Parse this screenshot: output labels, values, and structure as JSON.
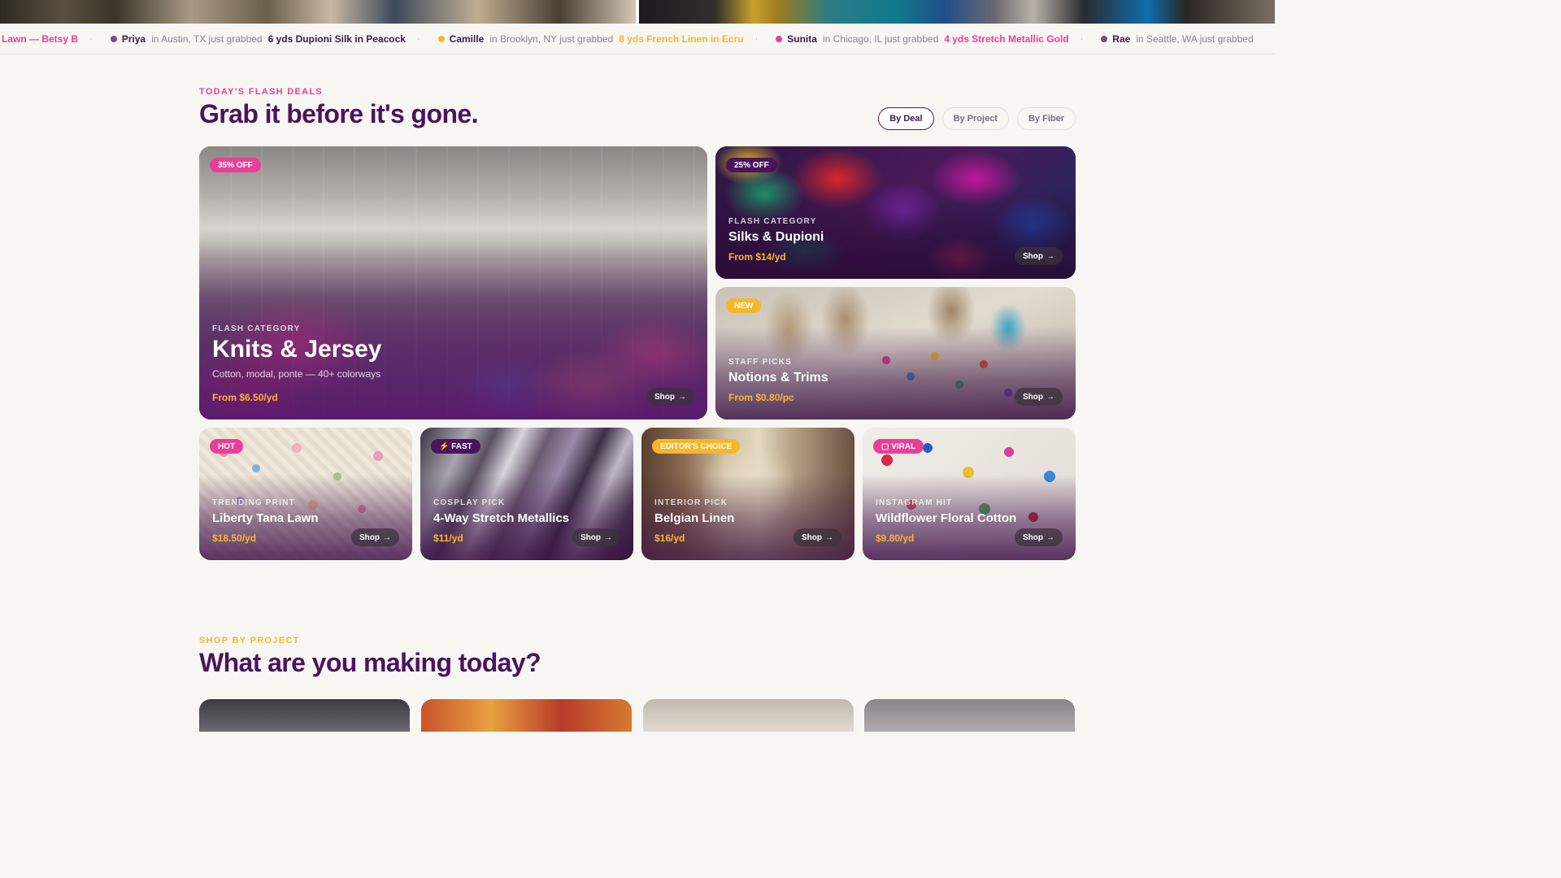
{
  "ticker": {
    "lead": "Lawn — Betsy B",
    "separator": "·",
    "items": [
      {
        "name": "Priya",
        "location": "in Austin, TX just grabbed",
        "product": "6 yds Dupioni Silk in Peacock",
        "dot_color": "#7a4b8a",
        "product_color": "#3a1a4a"
      },
      {
        "name": "Camille",
        "location": "in Brooklyn, NY just grabbed",
        "product": "8 yds French Linen in Ecru",
        "dot_color": "#f5b72a",
        "product_color": "#f5b72a"
      },
      {
        "name": "Sunita",
        "location": "in Chicago, IL just grabbed",
        "product": "4 yds Stretch Metallic Gold",
        "dot_color": "#e73f9a",
        "product_color": "#e73f9a"
      },
      {
        "name": "Rae",
        "location": "in Seattle, WA just grabbed",
        "product": "",
        "dot_color": "#7a4b8a",
        "product_color": "#3a1a4a"
      }
    ]
  },
  "flash": {
    "eyebrow": "TODAY'S FLASH DEALS",
    "title": "Grab it before it's gone.",
    "filters": [
      {
        "label": "By Deal",
        "active": true
      },
      {
        "label": "By Project",
        "active": false
      },
      {
        "label": "By Fiber",
        "active": false
      }
    ],
    "shop_label": "Shop",
    "shop_arrow": "→",
    "cards": {
      "knits": {
        "badge": "35% OFF",
        "category": "FLASH CATEGORY",
        "title": "Knits & Jersey",
        "subtitle": "Cotton, modal, ponte — 40+ colorways",
        "price": "From $6.50/yd"
      },
      "silks": {
        "badge": "25% OFF",
        "category": "FLASH CATEGORY",
        "title": "Silks & Dupioni",
        "price": "From $14/yd"
      },
      "notions": {
        "badge": "NEW",
        "category": "STAFF PICKS",
        "title": "Notions & Trims",
        "price": "From $0.80/pc"
      },
      "liberty": {
        "badge": "HOT",
        "category": "TRENDING PRINT",
        "title": "Liberty Tana Lawn",
        "price": "$18.50/yd"
      },
      "metallics": {
        "badge": "⚡ FAST",
        "category": "COSPLAY PICK",
        "title": "4-Way Stretch Metallics",
        "price": "$11/yd"
      },
      "linen": {
        "badge": "EDITOR'S CHOICE",
        "category": "INTERIOR PICK",
        "title": "Belgian Linen",
        "price": "$16/yd"
      },
      "floral": {
        "badge": "▢ VIRAL",
        "category": "INSTAGRAM HIT",
        "title": "Wildflower Floral Cotton",
        "price": "$9.80/yd"
      }
    }
  },
  "project": {
    "eyebrow": "SHOP BY PROJECT",
    "title": "What are you making today?"
  },
  "colors": {
    "pink": "#e73f9a",
    "purple": "#4a145c",
    "gold": "#f5b72a",
    "background": "#f8f6f3"
  }
}
